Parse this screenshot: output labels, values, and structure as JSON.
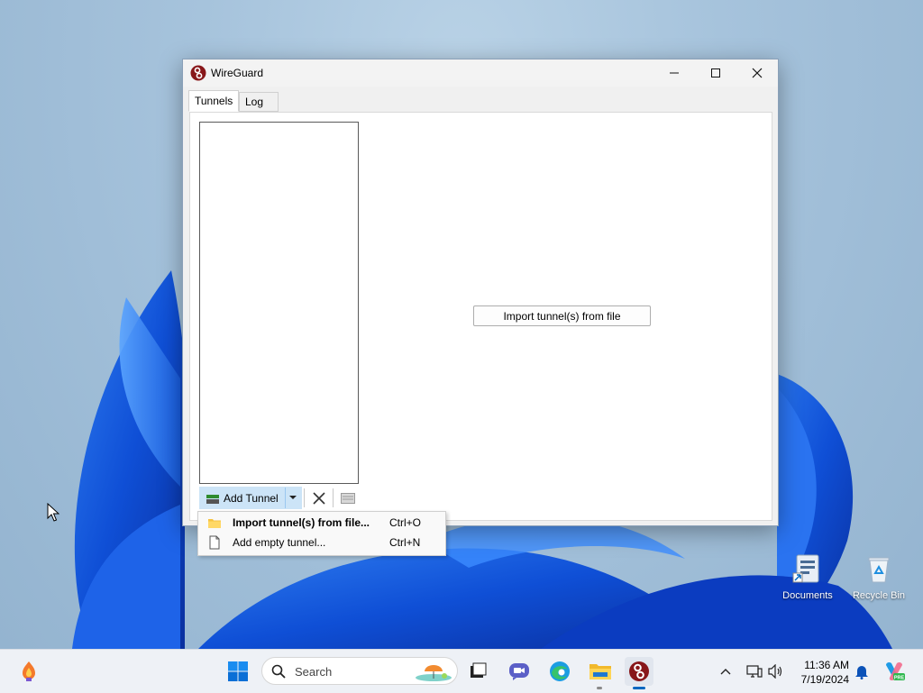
{
  "window": {
    "title": "WireGuard",
    "icon": "wireguard-logo-icon",
    "controls": {
      "minimize": "minimize-icon",
      "maximize": "maximize-icon",
      "close": "close-icon"
    }
  },
  "tabs": [
    {
      "label": "Tunnels",
      "active": true
    },
    {
      "label": "Log",
      "active": false
    }
  ],
  "main": {
    "import_button_label": "Import tunnel(s) from file"
  },
  "toolbar": {
    "add_tunnel_label": "Add Tunnel",
    "delete_icon": "delete-x-icon",
    "export_icon": "export-zip-icon"
  },
  "menu": {
    "items": [
      {
        "label": "Import tunnel(s) from file...",
        "shortcut": "Ctrl+O",
        "icon": "folder-icon",
        "bold": true
      },
      {
        "label": "Add empty tunnel...",
        "shortcut": "Ctrl+N",
        "icon": "blank-document-icon",
        "bold": false
      }
    ]
  },
  "desktop": {
    "icons": [
      {
        "label": "Documents",
        "icon": "documents-shortcut-icon"
      },
      {
        "label": "Recycle Bin",
        "icon": "recycle-bin-icon"
      }
    ]
  },
  "taskbar": {
    "search_placeholder": "Search",
    "apps": [
      "widgets-icon",
      "start-icon",
      "search-icon",
      "task-view-icon",
      "teams-meet-icon",
      "edge-icon",
      "file-explorer-icon",
      "wireguard-icon"
    ],
    "tray": [
      "chevron-up-icon",
      "network-icon",
      "volume-icon",
      "notification-bell-icon",
      "copilot-icon"
    ],
    "time": "11:36 AM",
    "date": "7/19/2024"
  },
  "colors": {
    "accent": "#0067c0",
    "add_tunnel_highlight": "#cce4f7",
    "wireguard_red": "#88171a"
  }
}
